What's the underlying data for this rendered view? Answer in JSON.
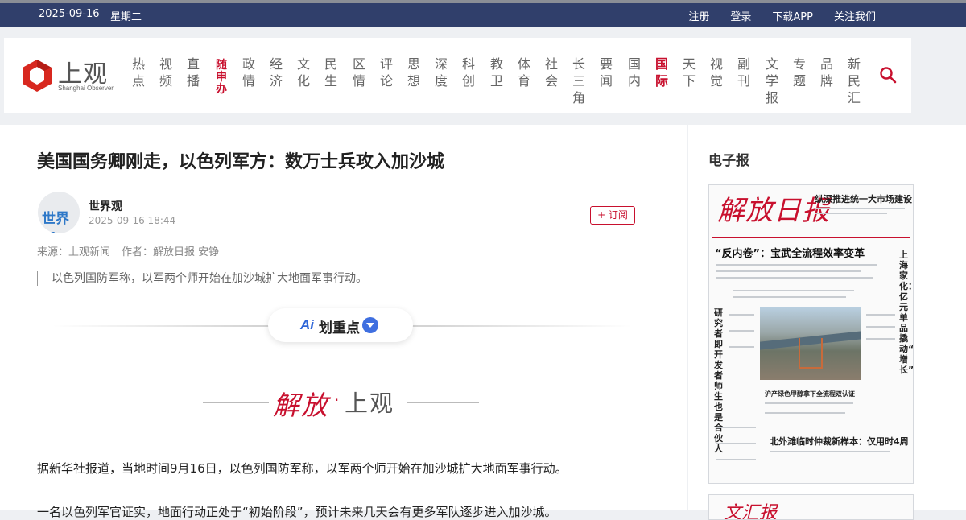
{
  "topbar": {
    "date": "2025-09-16",
    "weekday": "星期二",
    "links": [
      "注册",
      "登录",
      "下载APP",
      "关注我们"
    ]
  },
  "logo": {
    "cn": "上观",
    "en": "Shanghai Observer"
  },
  "nav": [
    {
      "label": "热点"
    },
    {
      "label": "视频"
    },
    {
      "label": "直播"
    },
    {
      "label": "随申办",
      "special": true
    },
    {
      "label": "政情"
    },
    {
      "label": "经济"
    },
    {
      "label": "文化"
    },
    {
      "label": "民生"
    },
    {
      "label": "区情"
    },
    {
      "label": "评论"
    },
    {
      "label": "思想"
    },
    {
      "label": "深度"
    },
    {
      "label": "科创"
    },
    {
      "label": "教卫"
    },
    {
      "label": "体育"
    },
    {
      "label": "社会"
    },
    {
      "label": "长三角"
    },
    {
      "label": "要闻"
    },
    {
      "label": "国内"
    },
    {
      "label": "国际",
      "active": true
    },
    {
      "label": "天下"
    },
    {
      "label": "视觉"
    },
    {
      "label": "副刊"
    },
    {
      "label": "文学报"
    },
    {
      "label": "专题"
    },
    {
      "label": "品牌"
    },
    {
      "label": "新民汇"
    }
  ],
  "search": {
    "icon": "search-icon"
  },
  "article": {
    "title": "美国国务卿刚走，以色列军方：数万士兵攻入加沙城",
    "author": {
      "name": "世界观",
      "avatar_text": "世界观",
      "date": "2025-09-16 18:44"
    },
    "subscribe_label": "+ 订阅",
    "source_label": "来源：上观新闻",
    "writer_label": "作者：解放日报 安铮",
    "summary": "以色列国防军称，以军两个师开始在加沙城扩大地面军事行动。",
    "ai_button": {
      "logo": "Ai",
      "label": "划重点"
    },
    "brand": {
      "left": "解放",
      "dot": "·",
      "right": "上观"
    },
    "paragraphs": [
      "据新华社报道，当地时间9月16日，以色列国防军称，以军两个师开始在加沙城扩大地面军事行动。",
      "一名以色列军官证实，地面行动正处于“初始阶段”，预计未来几天会有更多军队逐步进入加沙城。"
    ]
  },
  "sidebar": {
    "title": "电子报",
    "epaper": {
      "masthead": "解放日报",
      "headline1": "纵深推进统一大市场建设",
      "headline2": "“反内卷”：宝武全流程效率变革",
      "side_headline": "上海家化：亿元单品撬动“新增长”",
      "left_headline": "研究者即开发者 师生也是合伙人",
      "photo_caption": "沪产绿色甲醇拿下全流程双认证",
      "headline4": "北外滩临时仲裁新样本：仅用时4周"
    },
    "epaper2_masthead": "文汇报"
  },
  "colors": {
    "accent": "#c8102e",
    "topbar": "#303f6b",
    "ai_blue": "#3f6fe0"
  }
}
